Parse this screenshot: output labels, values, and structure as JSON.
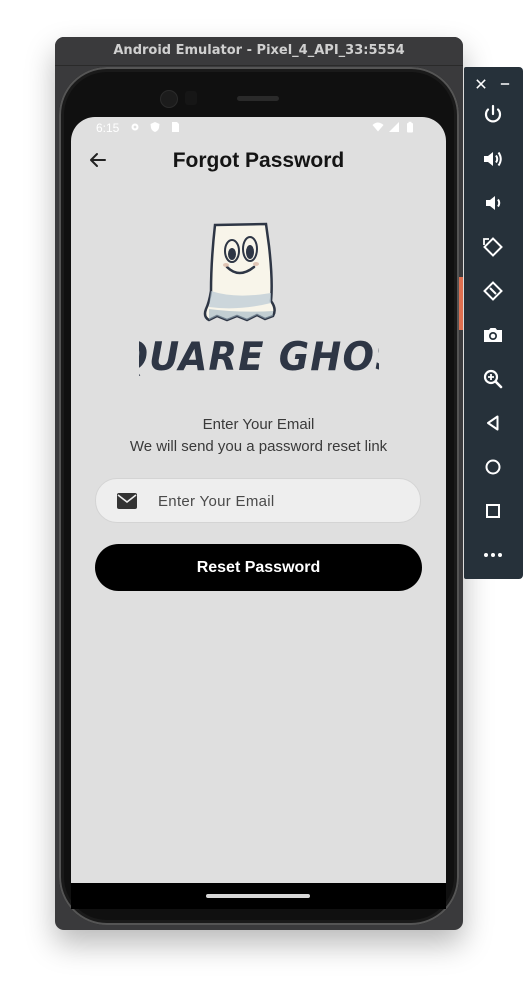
{
  "emulator": {
    "title": "Android Emulator - Pixel_4_API_33:5554",
    "side_panel": {
      "close_icon": "close-icon",
      "minimize_icon": "minimize-icon",
      "buttons": [
        {
          "name": "power-icon"
        },
        {
          "name": "volume-up-icon"
        },
        {
          "name": "volume-down-icon"
        },
        {
          "name": "rotate-left-icon"
        },
        {
          "name": "rotate-right-icon"
        },
        {
          "name": "camera-icon"
        },
        {
          "name": "zoom-icon"
        },
        {
          "name": "back-icon"
        },
        {
          "name": "home-icon"
        },
        {
          "name": "overview-icon"
        },
        {
          "name": "more-icon"
        }
      ]
    }
  },
  "status_bar": {
    "time": "6:15"
  },
  "app_bar": {
    "title": "Forgot Password",
    "back_icon": "arrow-left-icon"
  },
  "logo": {
    "text": "SQUARE GHOST"
  },
  "instructions": {
    "line1": "Enter Your Email",
    "line2": "We will send you a password reset link"
  },
  "email_field": {
    "placeholder": "Enter Your Email",
    "value": "",
    "icon": "mail-icon"
  },
  "reset_button": {
    "label": "Reset Password"
  },
  "colors": {
    "screen_bg": "#dfdfdf",
    "button_bg": "#000000",
    "button_text": "#ffffff",
    "field_bg": "#eeeeee",
    "panel_bg": "#26313a"
  }
}
